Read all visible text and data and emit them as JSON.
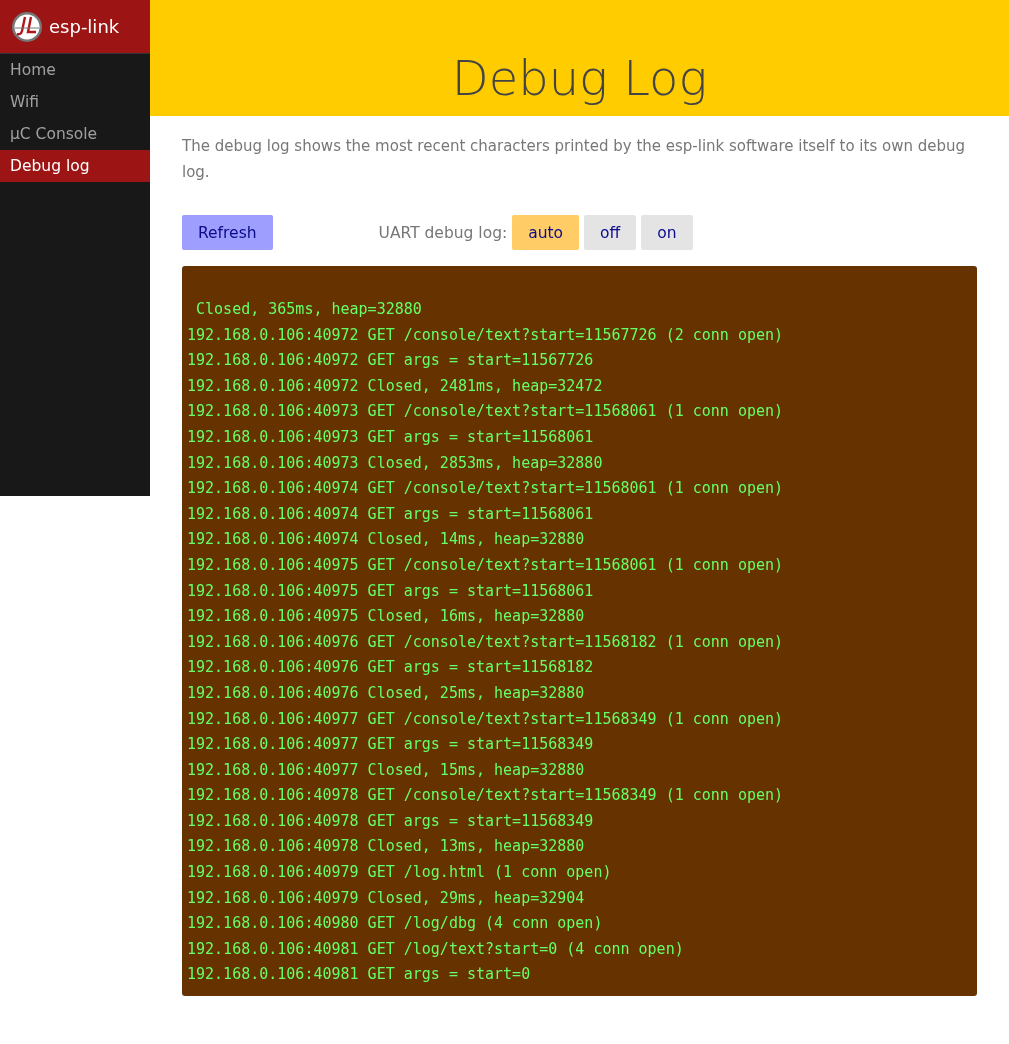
{
  "brand": {
    "name": "esp-link"
  },
  "sidebar": {
    "items": [
      {
        "label": "Home",
        "selected": false
      },
      {
        "label": "Wifi",
        "selected": false
      },
      {
        "label": "µC Console",
        "selected": false
      },
      {
        "label": "Debug log",
        "selected": true
      }
    ]
  },
  "header": {
    "title": "Debug Log"
  },
  "intro": "The debug log shows the most recent characters printed by the esp-link software itself to its own debug log.",
  "refresh_button": "Refresh",
  "uart": {
    "label": "UART debug log:",
    "options": [
      {
        "label": "auto",
        "selected": true
      },
      {
        "label": "off",
        "selected": false
      },
      {
        "label": "on",
        "selected": false
      }
    ]
  },
  "log_lines": [
    " Closed, 365ms, heap=32880",
    "192.168.0.106:40972 GET /console/text?start=11567726 (2 conn open)",
    "192.168.0.106:40972 GET args = start=11567726",
    "192.168.0.106:40972 Closed, 2481ms, heap=32472",
    "192.168.0.106:40973 GET /console/text?start=11568061 (1 conn open)",
    "192.168.0.106:40973 GET args = start=11568061",
    "192.168.0.106:40973 Closed, 2853ms, heap=32880",
    "192.168.0.106:40974 GET /console/text?start=11568061 (1 conn open)",
    "192.168.0.106:40974 GET args = start=11568061",
    "192.168.0.106:40974 Closed, 14ms, heap=32880",
    "192.168.0.106:40975 GET /console/text?start=11568061 (1 conn open)",
    "192.168.0.106:40975 GET args = start=11568061",
    "192.168.0.106:40975 Closed, 16ms, heap=32880",
    "192.168.0.106:40976 GET /console/text?start=11568182 (1 conn open)",
    "192.168.0.106:40976 GET args = start=11568182",
    "192.168.0.106:40976 Closed, 25ms, heap=32880",
    "192.168.0.106:40977 GET /console/text?start=11568349 (1 conn open)",
    "192.168.0.106:40977 GET args = start=11568349",
    "192.168.0.106:40977 Closed, 15ms, heap=32880",
    "192.168.0.106:40978 GET /console/text?start=11568349 (1 conn open)",
    "192.168.0.106:40978 GET args = start=11568349",
    "192.168.0.106:40978 Closed, 13ms, heap=32880",
    "192.168.0.106:40979 GET /log.html (1 conn open)",
    "192.168.0.106:40979 Closed, 29ms, heap=32904",
    "192.168.0.106:40980 GET /log/dbg (4 conn open)",
    "192.168.0.106:40981 GET /log/text?start=0 (4 conn open)",
    "192.168.0.106:40981 GET args = start=0"
  ]
}
